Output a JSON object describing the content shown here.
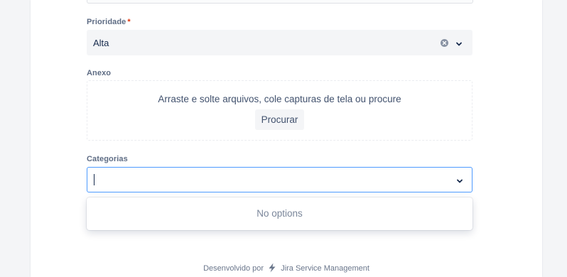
{
  "priority": {
    "label": "Prioridade",
    "required_mark": "*",
    "value": "Alta"
  },
  "attachment": {
    "label": "Anexo",
    "drop_text": "Arraste e solte arquivos, cole capturas de tela ou procure",
    "browse_label": "Procurar"
  },
  "categories": {
    "label": "Categorias",
    "input_value": "",
    "menu_empty_text": "No options"
  },
  "footer": {
    "powered_by": "Desenvolvido por",
    "product": "Jira Service Management"
  },
  "colors": {
    "focus_border": "#4c9aff",
    "required": "#de350b",
    "field_bg": "#f4f5f7"
  }
}
